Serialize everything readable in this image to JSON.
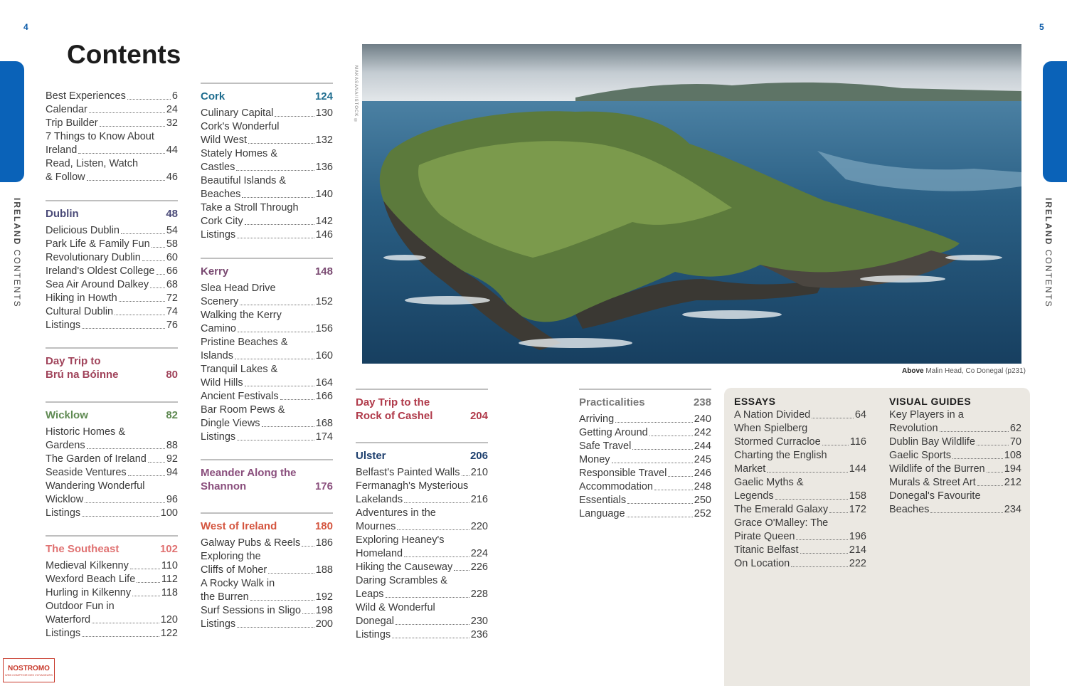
{
  "page": {
    "left_number": "4",
    "right_number": "5",
    "title": "Contents",
    "side_label_bold": "IRELAND",
    "side_label": "CONTENTS"
  },
  "intro": [
    {
      "t": "Best Experiences",
      "p": "6"
    },
    {
      "t": "Calendar",
      "p": "24"
    },
    {
      "t": "Trip Builder",
      "p": "32"
    },
    {
      "pre": "7 Things to Know About",
      "t": "Ireland",
      "p": "44"
    },
    {
      "pre": "Read, Listen, Watch",
      "t": "& Follow",
      "p": "46"
    }
  ],
  "dublin": {
    "title": "Dublin",
    "page": "48",
    "color": "#4a4a78",
    "items": [
      {
        "t": "Delicious Dublin",
        "p": "54"
      },
      {
        "t": "Park Life & Family Fun",
        "p": "58"
      },
      {
        "t": "Revolutionary Dublin",
        "p": "60"
      },
      {
        "t": "Ireland's Oldest College",
        "p": "66"
      },
      {
        "t": "Sea Air Around Dalkey",
        "p": "68"
      },
      {
        "t": "Hiking in Howth",
        "p": "72"
      },
      {
        "t": "Cultural Dublin",
        "p": "74"
      },
      {
        "t": "Listings",
        "p": "76"
      }
    ]
  },
  "bru": {
    "title": "Day Trip to\nBrú na Bóinne",
    "page": "80",
    "color": "#a0435a"
  },
  "wicklow": {
    "title": "Wicklow",
    "page": "82",
    "color": "#5f8a52",
    "items": [
      {
        "pre": "Historic Homes &",
        "t": "Gardens",
        "p": "88"
      },
      {
        "t": "The Garden of Ireland",
        "p": "92"
      },
      {
        "t": "Seaside Ventures",
        "p": "94"
      },
      {
        "pre": "Wandering Wonderful",
        "t": "Wicklow",
        "p": "96"
      },
      {
        "t": "Listings",
        "p": "100"
      }
    ]
  },
  "southeast": {
    "title": "The Southeast",
    "page": "102",
    "color": "#e07272",
    "items": [
      {
        "t": "Medieval Kilkenny",
        "p": "110"
      },
      {
        "t": "Wexford Beach Life",
        "p": "112"
      },
      {
        "t": "Hurling in Kilkenny",
        "p": "118"
      },
      {
        "pre": "Outdoor Fun in",
        "t": "Waterford",
        "p": "120"
      },
      {
        "t": "Listings",
        "p": "122"
      }
    ]
  },
  "cork": {
    "title": "Cork",
    "page": "124",
    "color": "#1f6d8f",
    "items": [
      {
        "t": "Culinary Capital",
        "p": "130"
      },
      {
        "pre": "Cork's Wonderful",
        "t": "Wild West",
        "p": "132"
      },
      {
        "pre": "Stately Homes &",
        "t": "Castles",
        "p": "136"
      },
      {
        "pre": "Beautiful Islands &",
        "t": "Beaches",
        "p": "140"
      },
      {
        "pre": "Take a Stroll Through",
        "t": "Cork City",
        "p": "142"
      },
      {
        "t": "Listings",
        "p": "146"
      }
    ]
  },
  "kerry": {
    "title": "Kerry",
    "page": "148",
    "color": "#7a4a72",
    "items": [
      {
        "pre": "Slea Head Drive",
        "t": "Scenery",
        "p": "152"
      },
      {
        "pre": "Walking the Kerry",
        "t": "Camino",
        "p": "156"
      },
      {
        "pre": "Pristine Beaches &",
        "t": "Islands",
        "p": "160"
      },
      {
        "pre": "Tranquil Lakes &",
        "t": "Wild Hills",
        "p": "164"
      },
      {
        "t": "Ancient Festivals",
        "p": "166"
      },
      {
        "pre": "Bar Room Pews &",
        "t": "Dingle Views",
        "p": "168"
      },
      {
        "t": "Listings",
        "p": "174"
      }
    ]
  },
  "shannon": {
    "title": "Meander Along the\nShannon",
    "page": "176",
    "color": "#8a4f7d"
  },
  "west": {
    "title": "West of Ireland",
    "page": "180",
    "color": "#d4553f",
    "items": [
      {
        "t": "Galway Pubs & Reels",
        "p": "186"
      },
      {
        "pre": "Exploring the",
        "t": "Cliffs of Moher",
        "p": "188"
      },
      {
        "pre": "A Rocky Walk in",
        "t": "the Burren",
        "p": "192"
      },
      {
        "t": "Surf Sessions in Sligo",
        "p": "198"
      },
      {
        "t": "Listings",
        "p": "200"
      }
    ]
  },
  "cashel": {
    "title": "Day Trip to the\nRock of Cashel",
    "page": "204",
    "color": "#b03a4a"
  },
  "ulster": {
    "title": "Ulster",
    "page": "206",
    "color": "#1d3f6e",
    "items": [
      {
        "t": "Belfast's Painted Walls",
        "p": "210"
      },
      {
        "pre": "Fermanagh's Mysterious",
        "t": "Lakelands",
        "p": "216"
      },
      {
        "pre": "Adventures in the",
        "t": "Mournes",
        "p": "220"
      },
      {
        "pre": "Exploring Heaney's",
        "t": "Homeland",
        "p": "224"
      },
      {
        "t": "Hiking the Causeway",
        "p": "226"
      },
      {
        "pre": "Daring Scrambles &",
        "t": "Leaps",
        "p": "228"
      },
      {
        "pre": "Wild & Wonderful",
        "t": "Donegal",
        "p": "230"
      },
      {
        "t": "Listings",
        "p": "236"
      }
    ]
  },
  "practicalities": {
    "title": "Practicalities",
    "page": "238",
    "color": "#777777",
    "items": [
      {
        "t": "Arriving",
        "p": "240"
      },
      {
        "t": "Getting Around",
        "p": "242"
      },
      {
        "t": "Safe Travel",
        "p": "244"
      },
      {
        "t": "Money",
        "p": "245"
      },
      {
        "t": "Responsible Travel",
        "p": "246"
      },
      {
        "t": "Accommodation",
        "p": "248"
      },
      {
        "t": "Essentials",
        "p": "250"
      },
      {
        "t": "Language",
        "p": "252"
      }
    ]
  },
  "essays": {
    "title": "ESSAYS",
    "items": [
      {
        "t": "A Nation Divided",
        "p": "64"
      },
      {
        "pre": "When Spielberg",
        "t": "Stormed Curracloe",
        "p": "116"
      },
      {
        "pre": "Charting the English",
        "t": "Market",
        "p": "144"
      },
      {
        "pre": "Gaelic Myths &",
        "t": "Legends",
        "p": "158"
      },
      {
        "t": "The Emerald Galaxy",
        "p": "172"
      },
      {
        "pre": "Grace O'Malley: The",
        "t": "Pirate Queen",
        "p": "196"
      },
      {
        "t": "Titanic Belfast",
        "p": "214"
      },
      {
        "t": "On Location",
        "p": "222"
      }
    ]
  },
  "visual": {
    "title": "VISUAL GUIDES",
    "items": [
      {
        "pre": "Key Players in a",
        "t": "Revolution",
        "p": "62"
      },
      {
        "t": "Dublin Bay Wildlife",
        "p": "70"
      },
      {
        "t": "Gaelic Sports",
        "p": "108"
      },
      {
        "t": "Wildlife of the Burren",
        "p": "194"
      },
      {
        "t": "Murals & Street Art",
        "p": "212"
      },
      {
        "pre": "Donegal's Favourite",
        "t": "Beaches",
        "p": "234"
      }
    ]
  },
  "photo": {
    "side_credit": "MAKASANA/ISTOCK ©",
    "caption_bold": "Above",
    "caption": "Malin Head, Co Donegal (p231)"
  },
  "logo": {
    "name": "NOSTROMO",
    "tagline": "WEB COMPTOIR DES VOYAGEURS"
  }
}
